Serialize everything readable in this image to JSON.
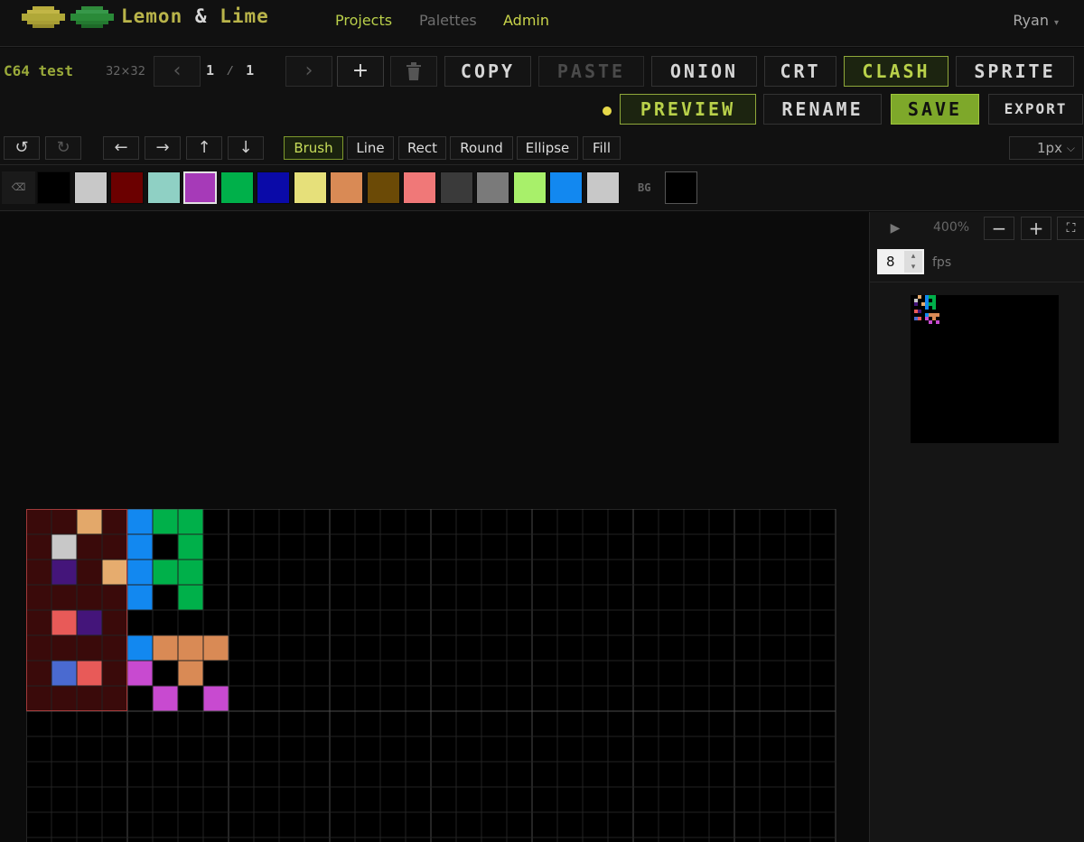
{
  "nav": {
    "brand_lemon": "Lemon",
    "brand_amp": "&",
    "brand_lime": "Lime",
    "links": [
      {
        "label": "Projects",
        "color": "#b9cf4a"
      },
      {
        "label": "Palettes",
        "color": "#6f6f6f"
      },
      {
        "label": "Admin",
        "color": "#c9d44a"
      }
    ],
    "user": "Ryan",
    "user_caret": "▾"
  },
  "project": {
    "name": "C64 test",
    "size": "32×32",
    "frame_current": "1",
    "frame_sep": "⁄",
    "frame_total": "1"
  },
  "toolbar": {
    "prev_icon": "‹",
    "next_icon": "›",
    "add_icon": "+",
    "copy": "COPY",
    "paste": "PASTE",
    "onion": "ONION",
    "crt": "CRT",
    "clash": "CLASH",
    "sprite": "SPRITE",
    "preview": "PREVIEW",
    "rename": "RENAME",
    "save": "SAVE",
    "export": "EXPORT"
  },
  "tools": {
    "undo_icon": "↺",
    "redo_icon": "↻",
    "shift_left": "←",
    "shift_right": "→",
    "shift_up": "↑",
    "shift_down": "↓",
    "brush": "Brush",
    "line": "Line",
    "rect": "Rect",
    "round": "Round",
    "ellipse": "Ellipse",
    "fill": "Fill",
    "brush_size": "1px",
    "brush_size_chevron": "⌵"
  },
  "palette": {
    "erase_icon": "⌫",
    "colors": [
      "#000000",
      "#c8c8c8",
      "#6b0000",
      "#8fd0c4",
      "#a63ab8",
      "#00b04a",
      "#0a0aa8",
      "#e6e07a",
      "#d98a55",
      "#6b4a06",
      "#f07878",
      "#3a3a3a",
      "#7a7a7a",
      "#a8f06a",
      "#1288f0",
      "#c8c8c8"
    ],
    "selected_index": 4,
    "bg_label": "BG",
    "bg_color": "#000000"
  },
  "preview_panel": {
    "play_icon": "▶",
    "zoom": "400%",
    "zoom_out": "−",
    "zoom_in": "+",
    "fullscreen_icon": "⛶",
    "fps_value": "8",
    "fps_spin_up": "▴",
    "fps_spin_down": "▾",
    "fps_label": "fps"
  },
  "sprite_pixels": [
    {
      "c": 2,
      "r": 0,
      "color": "#e3a86a"
    },
    {
      "c": 1,
      "r": 1,
      "color": "#c8c8c8"
    },
    {
      "c": 1,
      "r": 2,
      "color": "#44157a"
    },
    {
      "c": 3,
      "r": 2,
      "color": "#e6ac6e"
    },
    {
      "c": 1,
      "r": 4,
      "color": "#e85a58"
    },
    {
      "c": 2,
      "r": 4,
      "color": "#44157a"
    },
    {
      "c": 1,
      "r": 6,
      "color": "#4a6ad0"
    },
    {
      "c": 2,
      "r": 6,
      "color": "#e85a58"
    },
    {
      "c": 4,
      "r": 0,
      "color": "#1288f0"
    },
    {
      "c": 4,
      "r": 1,
      "color": "#1288f0"
    },
    {
      "c": 4,
      "r": 2,
      "color": "#1288f0"
    },
    {
      "c": 4,
      "r": 3,
      "color": "#1288f0"
    },
    {
      "c": 5,
      "r": 0,
      "color": "#00b04a"
    },
    {
      "c": 6,
      "r": 0,
      "color": "#00b04a"
    },
    {
      "c": 6,
      "r": 1,
      "color": "#00b04a"
    },
    {
      "c": 5,
      "r": 2,
      "color": "#00b04a"
    },
    {
      "c": 6,
      "r": 2,
      "color": "#00b04a"
    },
    {
      "c": 6,
      "r": 3,
      "color": "#00b04a"
    },
    {
      "c": 4,
      "r": 5,
      "color": "#1288f0"
    },
    {
      "c": 5,
      "r": 5,
      "color": "#d98a55"
    },
    {
      "c": 6,
      "r": 5,
      "color": "#d98a55"
    },
    {
      "c": 7,
      "r": 5,
      "color": "#d98a55"
    },
    {
      "c": 4,
      "r": 6,
      "color": "#c84ad0"
    },
    {
      "c": 6,
      "r": 6,
      "color": "#d98a55"
    },
    {
      "c": 5,
      "r": 7,
      "color": "#c84ad0"
    },
    {
      "c": 7,
      "r": 7,
      "color": "#c84ad0"
    }
  ],
  "clash_cell": {
    "color": "#3a0a0a",
    "border": "#a03a3a"
  }
}
